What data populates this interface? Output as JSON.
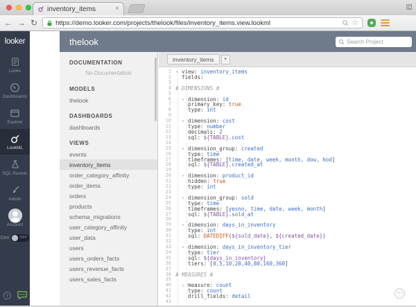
{
  "browser": {
    "tab_title": "inventory_items",
    "tab_close": "×",
    "url": "https://demo.looker.com/projects/thelook/files/inventory_items.view.lookml",
    "icons": {
      "back": "←",
      "forward": "→",
      "reload": "↻",
      "star": "☆"
    },
    "traffic_lights": [
      "#fc5753",
      "#fdbc40",
      "#33c748"
    ]
  },
  "nav": {
    "logo": "looker",
    "items": [
      {
        "id": "looks",
        "label": "Looks",
        "active": false
      },
      {
        "id": "dashboards",
        "label": "Dashboards",
        "active": false
      },
      {
        "id": "explore",
        "label": "Explore",
        "active": false
      },
      {
        "id": "lookml",
        "label": "LookML",
        "active": true
      },
      {
        "id": "sql-runner",
        "label": "SQL Runner",
        "active": false
      },
      {
        "id": "admin",
        "label": "Admin",
        "active": false
      },
      {
        "id": "account",
        "label": "Account",
        "active": false
      }
    ],
    "dev_label": "Dev",
    "dev_state": "OFF"
  },
  "header": {
    "title": "thelook",
    "search_placeholder": "Search Project"
  },
  "sidebar": {
    "sections": [
      {
        "title": "DOCUMENTATION",
        "empty_text": "No Documentation",
        "items": []
      },
      {
        "title": "MODELS",
        "items": [
          "thelook"
        ]
      },
      {
        "title": "DASHBOARDS",
        "items": [
          "dashboards"
        ]
      },
      {
        "title": "VIEWS",
        "selected": "inventory_items",
        "items": [
          "events",
          "inventory_items",
          "order_category_affinity",
          "order_items",
          "orders",
          "products",
          "schema_migrations",
          "user_category_affinity",
          "user_data",
          "users",
          "users_orders_facts",
          "users_revenue_facts",
          "users_sales_facts"
        ]
      }
    ]
  },
  "editor": {
    "tab_label": "inventory_items",
    "tab_caret": "▾",
    "lines": [
      [
        [
          "k",
          "- view: "
        ],
        [
          "v",
          "inventory_items"
        ]
      ],
      [
        [
          "k",
          "  fields:"
        ]
      ],
      [],
      [
        [
          "c",
          "# DIMENSIONS #"
        ]
      ],
      [],
      [
        [
          "k",
          "  - dimension: "
        ],
        [
          "v",
          "id"
        ]
      ],
      [
        [
          "k",
          "    primary_key: "
        ],
        [
          "o",
          "true"
        ]
      ],
      [
        [
          "k",
          "    type: "
        ],
        [
          "v",
          "int"
        ]
      ],
      [],
      [
        [
          "k",
          "  - dimension: "
        ],
        [
          "v",
          "cost"
        ]
      ],
      [
        [
          "k",
          "    type: "
        ],
        [
          "v",
          "number"
        ]
      ],
      [
        [
          "k",
          "    decimals: "
        ],
        [
          "v",
          "2"
        ]
      ],
      [
        [
          "k",
          "    sql: "
        ],
        [
          "p",
          "${TABLE}"
        ],
        [
          "k",
          "."
        ],
        [
          "v",
          "cost"
        ]
      ],
      [],
      [
        [
          "k",
          "  - dimension_group: "
        ],
        [
          "v",
          "created"
        ]
      ],
      [
        [
          "k",
          "    type: "
        ],
        [
          "v",
          "time"
        ]
      ],
      [
        [
          "k",
          "    timeframes: ["
        ],
        [
          "v",
          "time, date, week, month, dow, hod"
        ],
        [
          "k",
          "]"
        ]
      ],
      [
        [
          "k",
          "    sql: "
        ],
        [
          "p",
          "${TABLE}"
        ],
        [
          "k",
          "."
        ],
        [
          "v",
          "created_at"
        ]
      ],
      [],
      [
        [
          "k",
          "  - dimension: "
        ],
        [
          "v",
          "product_id"
        ]
      ],
      [
        [
          "k",
          "    hidden: "
        ],
        [
          "o",
          "true"
        ]
      ],
      [
        [
          "k",
          "    type: "
        ],
        [
          "v",
          "int"
        ]
      ],
      [],
      [
        [
          "k",
          "  - dimension_group: "
        ],
        [
          "v",
          "sold"
        ]
      ],
      [
        [
          "k",
          "    type: "
        ],
        [
          "v",
          "time"
        ]
      ],
      [
        [
          "k",
          "    timeframes: ["
        ],
        [
          "v",
          "yesno, time, date, week, month"
        ],
        [
          "k",
          "]"
        ]
      ],
      [
        [
          "k",
          "    sql: "
        ],
        [
          "p",
          "${TABLE}"
        ],
        [
          "k",
          "."
        ],
        [
          "v",
          "sold_at"
        ]
      ],
      [],
      [
        [
          "k",
          "  - dimension: "
        ],
        [
          "v",
          "days_in_inventory"
        ]
      ],
      [
        [
          "k",
          "    type: "
        ],
        [
          "v",
          "int"
        ]
      ],
      [
        [
          "k",
          "    sql: "
        ],
        [
          "o",
          "DATEDIFF"
        ],
        [
          "k",
          "("
        ],
        [
          "p",
          "${sold_date}"
        ],
        [
          "k",
          ", "
        ],
        [
          "p",
          "${created_date}"
        ],
        [
          "k",
          ")"
        ]
      ],
      [],
      [
        [
          "k",
          "  - dimension: "
        ],
        [
          "v",
          "days_in_inventory_tier"
        ]
      ],
      [
        [
          "k",
          "    type: "
        ],
        [
          "v",
          "tier"
        ]
      ],
      [
        [
          "k",
          "    sql: "
        ],
        [
          "p",
          "${days_in_inventory}"
        ]
      ],
      [
        [
          "k",
          "    tiers: ["
        ],
        [
          "v",
          "0,5,10,20,40,80,160,360"
        ],
        [
          "k",
          "]"
        ]
      ],
      [],
      [
        [
          "c",
          "# MEASURES #"
        ]
      ],
      [],
      [
        [
          "k",
          "  - measure: "
        ],
        [
          "v",
          "count"
        ]
      ],
      [
        [
          "k",
          "    type: "
        ],
        [
          "v",
          "count"
        ]
      ],
      [
        [
          "k",
          "    drill_fields: "
        ],
        [
          "v",
          "detail"
        ]
      ],
      []
    ]
  },
  "colors": {
    "nav_bg": "#343c4b",
    "nav_active_bg": "#272e3a",
    "header_bg": "#6f7a8b",
    "selected_bg": "#e1e1e1",
    "code_key": "#454545",
    "code_value": "#3a6bc0",
    "code_const": "#c25715",
    "code_var": "#8052a0",
    "code_comment": "#999999",
    "ext_green": "#57a957",
    "menu_orange": "#e39b3b",
    "chat_green": "#7fb357",
    "lock_green": "#3aa544"
  }
}
